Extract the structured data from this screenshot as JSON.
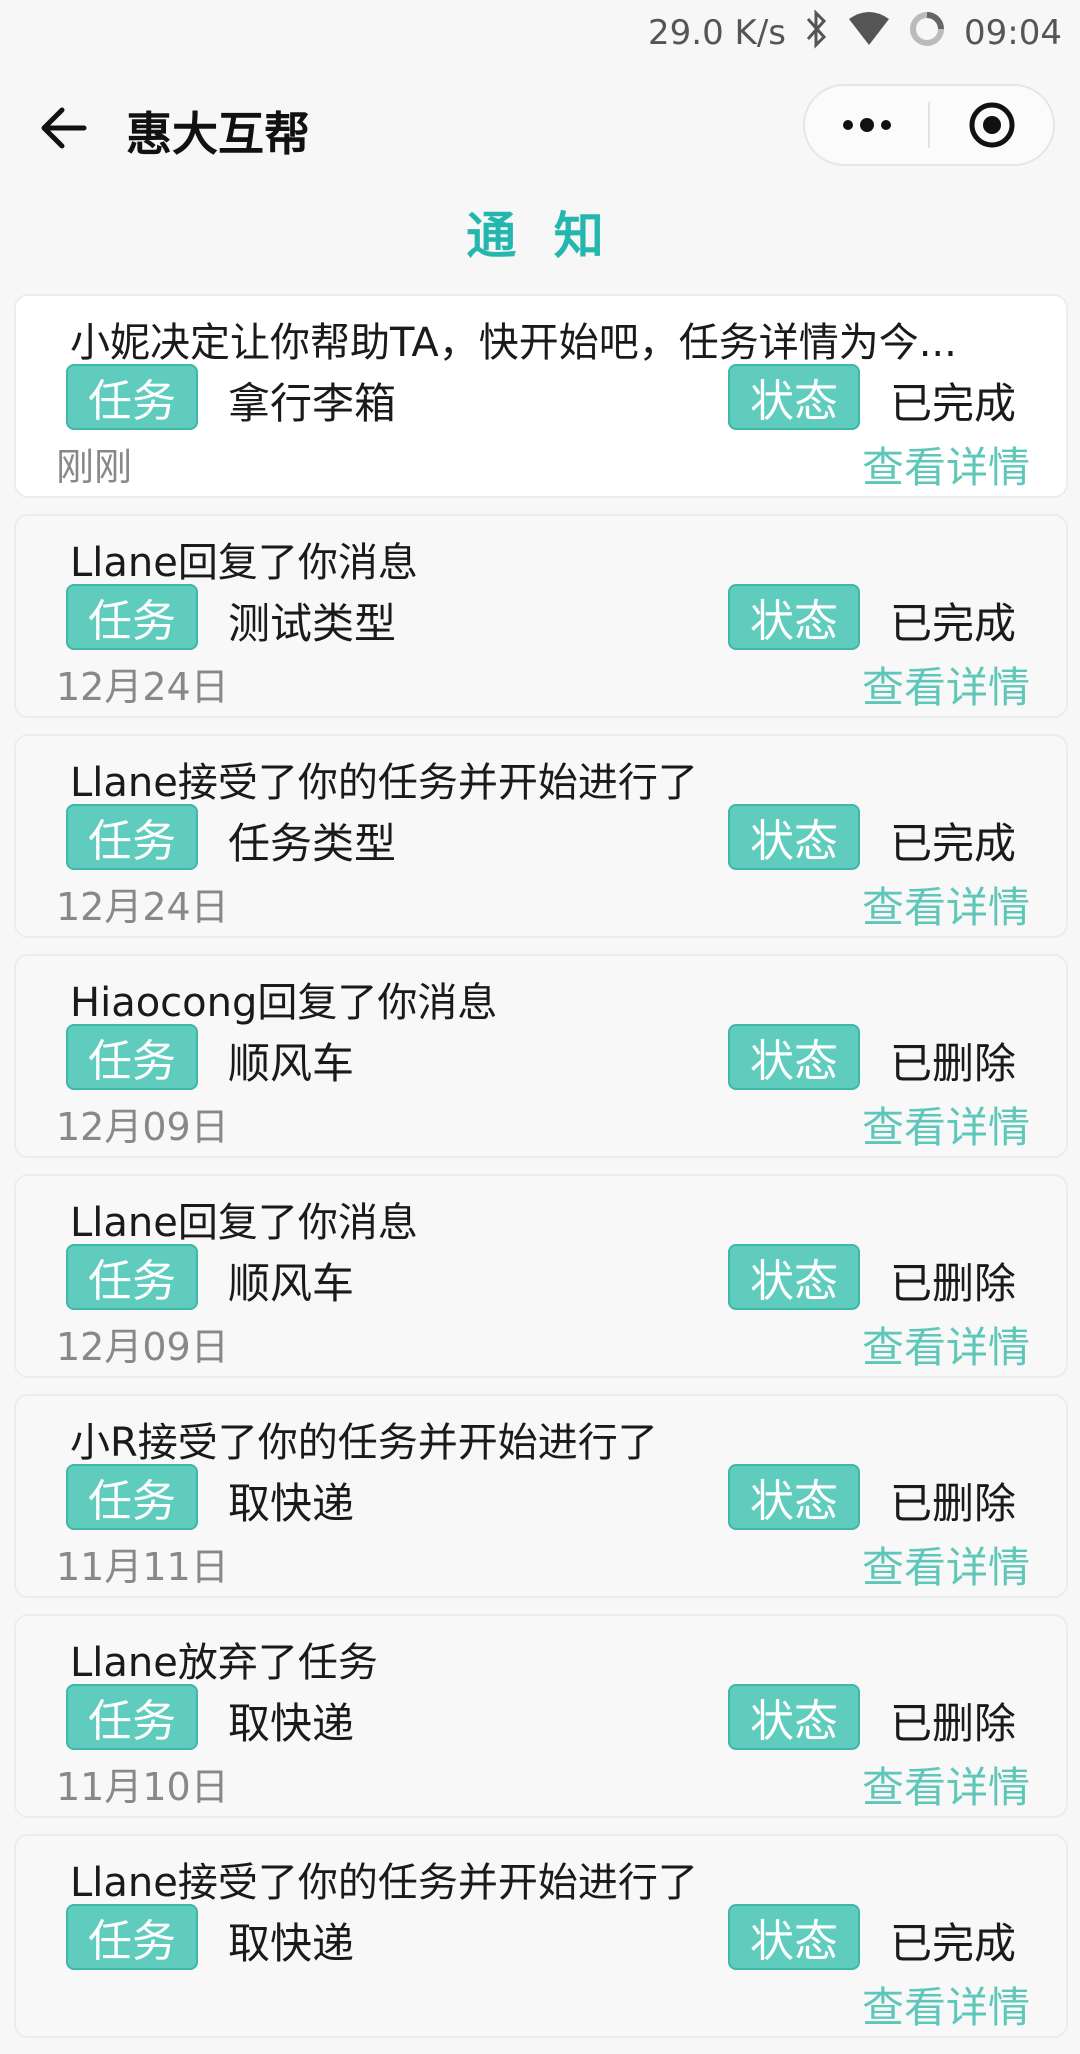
{
  "status": {
    "speed": "29.0 K/s",
    "time": "09:04"
  },
  "nav": {
    "title": "惠大互帮"
  },
  "heading": "通 知",
  "labels": {
    "task": "任务",
    "state": "状态",
    "detail": "查看详情"
  },
  "items": [
    {
      "message": "小妮决定让你帮助TA，快开始吧，任务详情为今...",
      "task": "拿行李箱",
      "state": "已完成",
      "date": "刚刚"
    },
    {
      "message": "Llane回复了你消息",
      "task": "测试类型",
      "state": "已完成",
      "date": "12月24日"
    },
    {
      "message": "Llane接受了你的任务并开始进行了",
      "task": "任务类型",
      "state": "已完成",
      "date": "12月24日"
    },
    {
      "message": "Hiaocong回复了你消息",
      "task": "顺风车",
      "state": "已删除",
      "date": "12月09日"
    },
    {
      "message": "Llane回复了你消息",
      "task": "顺风车",
      "state": "已删除",
      "date": "12月09日"
    },
    {
      "message": "小R接受了你的任务并开始进行了",
      "task": "取快递",
      "state": "已删除",
      "date": "11月11日"
    },
    {
      "message": "Llane放弃了任务",
      "task": "取快递",
      "state": "已删除",
      "date": "11月10日"
    },
    {
      "message": "Llane接受了你的任务并开始进行了",
      "task": "取快递",
      "state": "已完成",
      "date": ""
    }
  ]
}
